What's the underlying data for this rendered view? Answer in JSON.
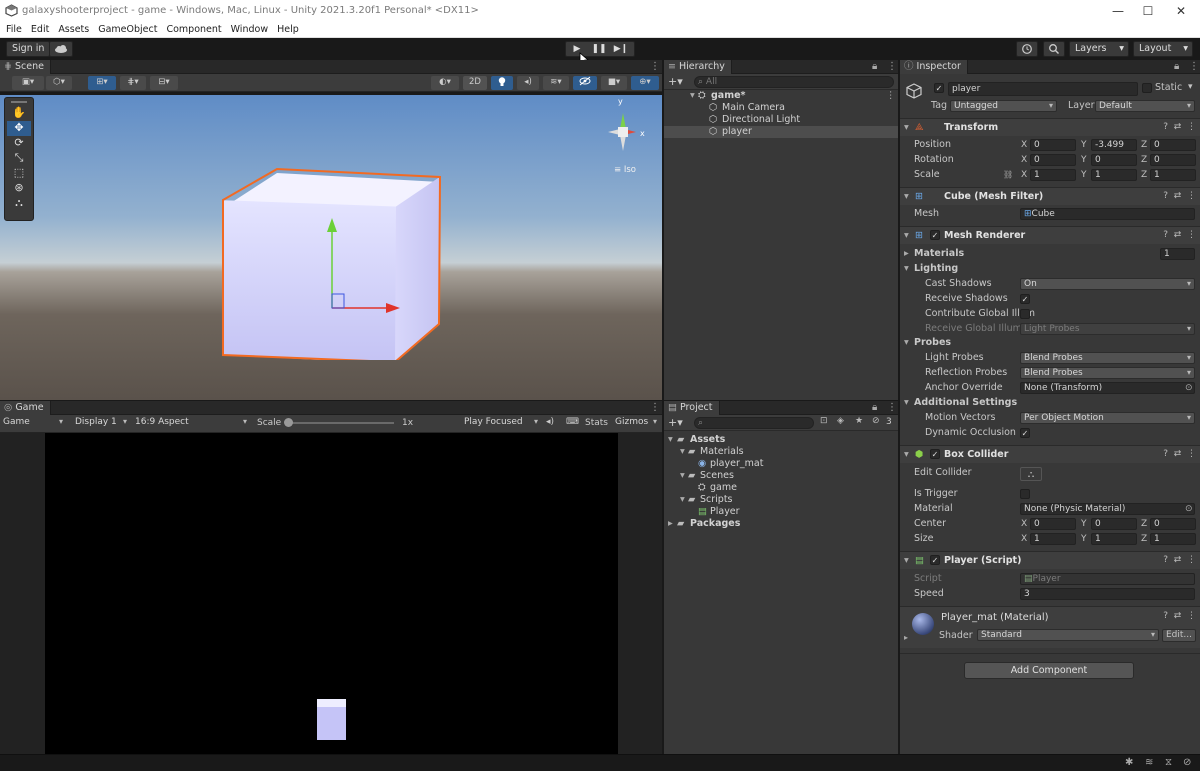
{
  "window": {
    "title": "galaxyshooterproject - game - Windows, Mac, Linux - Unity 2021.3.20f1 Personal* <DX11>",
    "minimize": "—",
    "maximize": "☐",
    "close": "✕"
  },
  "menu": [
    "File",
    "Edit",
    "Assets",
    "GameObject",
    "Component",
    "Window",
    "Help"
  ],
  "toolbar": {
    "sign_in": "Sign in",
    "cloud_icon": "cloud-icon",
    "layers": "Layers",
    "layout": "Layout"
  },
  "scene": {
    "tab": "Scene",
    "btn_2d": "2D",
    "iso_label": "Iso",
    "gizmo_x": "x",
    "gizmo_y": "y"
  },
  "game": {
    "tab": "Game",
    "mode": "Game",
    "display": "Display 1",
    "aspect": "16:9 Aspect",
    "scale_label": "Scale",
    "scale_value": "1x",
    "play_focused": "Play Focused",
    "stats": "Stats",
    "gizmos": "Gizmos"
  },
  "hierarchy": {
    "tab": "Hierarchy",
    "search_placeholder": "All",
    "scene_name": "game*",
    "items": [
      "Main Camera",
      "Directional Light",
      "player"
    ]
  },
  "project": {
    "tab": "Project",
    "hidden_count": "3",
    "tree": [
      {
        "label": "Assets"
      },
      {
        "label": "Materials"
      },
      {
        "label": "player_mat"
      },
      {
        "label": "Scenes"
      },
      {
        "label": "game"
      },
      {
        "label": "Scripts"
      },
      {
        "label": "Player"
      },
      {
        "label": "Packages"
      }
    ]
  },
  "inspector": {
    "tab": "Inspector",
    "object_name": "player",
    "static_label": "Static",
    "tag_label": "Tag",
    "tag_value": "Untagged",
    "layer_label": "Layer",
    "layer_value": "Default",
    "transform": {
      "title": "Transform",
      "position_label": "Position",
      "rotation_label": "Rotation",
      "scale_label": "Scale",
      "position": [
        "0",
        "-3.499",
        "0"
      ],
      "rotation": [
        "0",
        "0",
        "0"
      ],
      "scale": [
        "1",
        "1",
        "1"
      ],
      "axes": [
        "X",
        "Y",
        "Z"
      ]
    },
    "mesh_filter": {
      "title": "Cube (Mesh Filter)",
      "mesh_label": "Mesh",
      "mesh_value": "Cube"
    },
    "mesh_renderer": {
      "title": "Mesh Renderer",
      "materials_label": "Materials",
      "materials_count": "1",
      "lighting_label": "Lighting",
      "cast_shadows_label": "Cast Shadows",
      "cast_shadows_value": "On",
      "receive_shadows_label": "Receive Shadows",
      "contribute_gi_label": "Contribute Global Illum",
      "receive_gi_label": "Receive Global Illumin",
      "receive_gi_value": "Light Probes",
      "probes_label": "Probes",
      "light_probes_label": "Light Probes",
      "light_probes_value": "Blend Probes",
      "reflection_probes_label": "Reflection Probes",
      "reflection_probes_value": "Blend Probes",
      "anchor_override_label": "Anchor Override",
      "anchor_override_value": "None (Transform)",
      "additional_label": "Additional Settings",
      "motion_vectors_label": "Motion Vectors",
      "motion_vectors_value": "Per Object Motion",
      "dynamic_occlusion_label": "Dynamic Occlusion"
    },
    "box_collider": {
      "title": "Box Collider",
      "edit_collider_label": "Edit Collider",
      "is_trigger_label": "Is Trigger",
      "material_label": "Material",
      "material_value": "None (Physic Material)",
      "center_label": "Center",
      "size_label": "Size",
      "center": [
        "0",
        "0",
        "0"
      ],
      "size": [
        "1",
        "1",
        "1"
      ]
    },
    "player_script": {
      "title": "Player (Script)",
      "script_label": "Script",
      "script_value": "Player",
      "speed_label": "Speed",
      "speed_value": "3"
    },
    "material": {
      "title": "Player_mat (Material)",
      "shader_label": "Shader",
      "shader_value": "Standard",
      "edit_label": "Edit..."
    },
    "add_component": "Add Component"
  },
  "colors": {
    "selection_outline": "#f26a22",
    "cube_face": "#c9c8f6",
    "panel_bg": "#383838",
    "tab_active": "#3c3c3c",
    "highlight_blue": "#2f5d8f"
  }
}
